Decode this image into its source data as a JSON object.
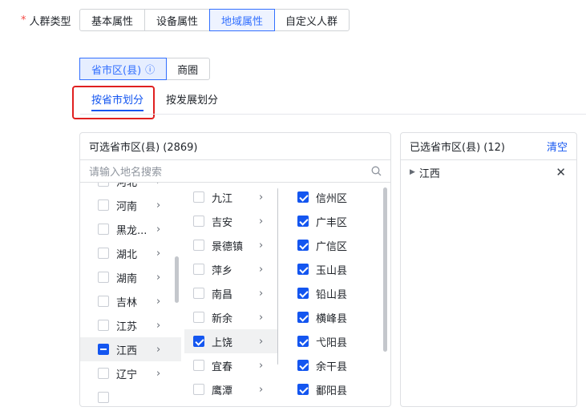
{
  "field": {
    "required_mark": "*",
    "label": "人群类型"
  },
  "type_options": [
    {
      "label": "基本属性",
      "active": false
    },
    {
      "label": "设备属性",
      "active": false
    },
    {
      "label": "地域属性",
      "active": true
    },
    {
      "label": "自定义人群",
      "active": false
    }
  ],
  "region_mode": {
    "options": [
      {
        "label": "省市区(县)",
        "info_icon": "ⓘ",
        "active": true
      },
      {
        "label": "商圈",
        "active": false
      }
    ]
  },
  "sub_tabs": [
    {
      "label": "按省市划分",
      "active": true
    },
    {
      "label": "按发展划分",
      "active": false
    }
  ],
  "selectable": {
    "title": "可选省市区(县) (2869)",
    "search_placeholder": "请输入地名搜索",
    "provinces": [
      {
        "label": "河北",
        "state": "none"
      },
      {
        "label": "河南",
        "state": "none"
      },
      {
        "label": "黑龙...",
        "state": "none"
      },
      {
        "label": "湖北",
        "state": "none"
      },
      {
        "label": "湖南",
        "state": "none"
      },
      {
        "label": "吉林",
        "state": "none"
      },
      {
        "label": "江苏",
        "state": "none"
      },
      {
        "label": "江西",
        "state": "partial"
      },
      {
        "label": "辽宁",
        "state": "none"
      }
    ],
    "cities": [
      {
        "label": "九江",
        "checked": false
      },
      {
        "label": "吉安",
        "checked": false
      },
      {
        "label": "景德镇",
        "checked": false
      },
      {
        "label": "萍乡",
        "checked": false
      },
      {
        "label": "南昌",
        "checked": false
      },
      {
        "label": "新余",
        "checked": false
      },
      {
        "label": "上饶",
        "checked": true
      },
      {
        "label": "宜春",
        "checked": false
      },
      {
        "label": "鹰潭",
        "checked": false
      }
    ],
    "districts": [
      {
        "label": "信州区",
        "checked": true
      },
      {
        "label": "广丰区",
        "checked": true
      },
      {
        "label": "广信区",
        "checked": true
      },
      {
        "label": "玉山县",
        "checked": true
      },
      {
        "label": "铅山县",
        "checked": true
      },
      {
        "label": "横峰县",
        "checked": true
      },
      {
        "label": "弋阳县",
        "checked": true
      },
      {
        "label": "余干县",
        "checked": true
      },
      {
        "label": "鄱阳县",
        "checked": true
      }
    ]
  },
  "selected": {
    "title": "已选省市区(县) (12)",
    "clear_label": "清空",
    "items": [
      {
        "label": "江西"
      }
    ]
  },
  "icons": {
    "chevron": "›",
    "search": "search-icon",
    "expand": "▶",
    "close": "✕"
  },
  "colors": {
    "accent": "#1456f0",
    "highlight_box": "#e02020"
  }
}
